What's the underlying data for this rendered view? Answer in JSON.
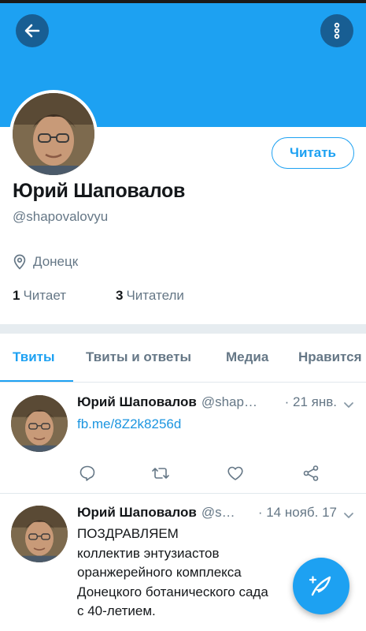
{
  "profile": {
    "name": "Юрий Шаповалов",
    "handle": "@shapovalovyu",
    "location": "Донецк",
    "following_count": "1",
    "following_label": "Читает",
    "followers_count": "3",
    "followers_label": "Читатели",
    "follow_button_label": "Читать"
  },
  "header": {
    "back_icon": "arrow-left-icon",
    "more_icon": "vertical-dots-icon"
  },
  "tabs": [
    {
      "label": "Твиты",
      "active": true
    },
    {
      "label": "Твиты и ответы",
      "active": false
    },
    {
      "label": "Медиа",
      "active": false
    },
    {
      "label": "Нравится",
      "active": false
    }
  ],
  "tweets": [
    {
      "name": "Юрий Шаповалов",
      "handle": "@shap…",
      "date": "· 21 янв.",
      "link": "fb.me/8Z2k8256d",
      "actions": [
        "reply-icon",
        "retweet-icon",
        "like-icon",
        "share-icon"
      ]
    },
    {
      "name": "Юрий Шаповалов",
      "handle": "@s…",
      "date": "· 14 нояб. 17",
      "lines": [
        "ПОЗДРАВЛЯЕМ",
        "коллектив энтузиастов",
        "оранжерейного комплекса",
        "Донецкого ботанического сада",
        "с 40-летием."
      ]
    }
  ],
  "fab": {
    "icon": "compose-feather-icon"
  },
  "colors": {
    "accent": "#1da1f2",
    "banner": "#1da1f2",
    "secondary_text": "#657786",
    "divider": "#e6ecf0"
  }
}
